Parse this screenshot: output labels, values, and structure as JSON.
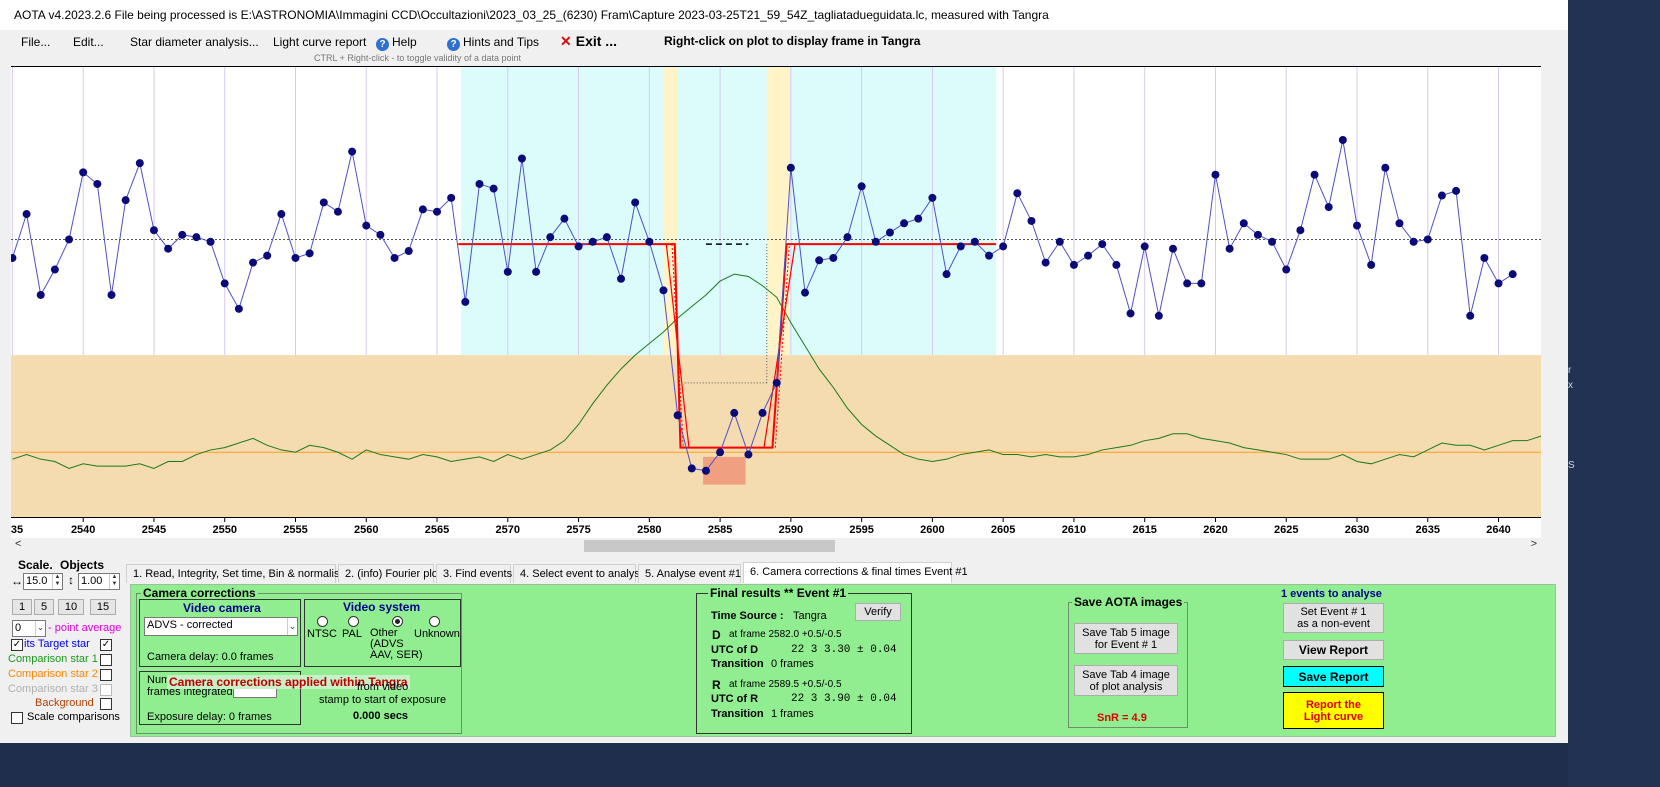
{
  "window": {
    "title": "AOTA v4.2023.2.6    File being processed is E:\\ASTRONOMIA\\Immagini CCD\\Occultazioni\\2023_03_25_(6230) Fram\\Capture 2023-03-25T21_59_54Z_tagliatadueguidata.lc, measured with Tangra"
  },
  "menu": {
    "file": "File...",
    "edit": "Edit...",
    "star_diameter": "Star diameter analysis...",
    "light_curve_report": "Light curve report",
    "help": "Help",
    "hints": "Hints and Tips",
    "exit": "Exit ...",
    "right_click_hint": "Right-click on plot to display frame in Tangra",
    "ctrl_hint": "CTRL + Right-click  -  to toggle validity of a data point"
  },
  "icons": {
    "help": "question-circle-icon",
    "hints": "question-circle-icon",
    "exit": "close-x-icon"
  },
  "colors": {
    "data_point": "#0a0a78",
    "data_line": "#5050c8",
    "model": "#ff0000",
    "comparison_green": "#1a7a1a",
    "background_orange": "#ffa020",
    "lower_band": "#f5dbb0",
    "cyan_region": "#dcfcfc",
    "yellow_region": "#fff4c8",
    "panel_green": "#90ee90",
    "save_report": "#00ffff",
    "report_light_curve": "#ffff00",
    "snr": "#e00000"
  },
  "chart_data": {
    "type": "line",
    "xlim": [
      2534.9,
      2643.0
    ],
    "x_ticks": [
      2540,
      2545,
      2550,
      2555,
      2560,
      2565,
      2570,
      2575,
      2580,
      2585,
      2590,
      2595,
      2600,
      2605,
      2610,
      2615,
      2620,
      2625,
      2630,
      2635,
      2640
    ],
    "x_tick_labels": [
      "35",
      "2540",
      "2545",
      "2550",
      "2555",
      "2560",
      "2565",
      "2570",
      "2575",
      "2580",
      "2585",
      "2590",
      "2595",
      "2600",
      "2605",
      "2610",
      "2615",
      "2620",
      "2625",
      "2630",
      "2635",
      "2640"
    ],
    "ylim": [
      -0.2,
      1.75
    ],
    "grid": true,
    "baseline_level": 1.0,
    "regions": [
      {
        "kind": "cyan",
        "x_from": 2566.7,
        "x_to": 2581.0
      },
      {
        "kind": "yellow",
        "x_from": 2581.0,
        "x_to": 2582.0
      },
      {
        "kind": "cyan",
        "x_from": 2582.0,
        "x_to": 2588.3
      },
      {
        "kind": "yellow",
        "x_from": 2588.3,
        "x_to": 2589.9
      },
      {
        "kind": "cyan",
        "x_from": 2589.9,
        "x_to": 2604.5
      },
      {
        "kind": "salmon",
        "x_from": 2583.8,
        "x_to": 2586.8,
        "y_from": -0.06,
        "y_to": 0.06
      }
    ],
    "lower_band_below": 0.5,
    "series": [
      {
        "name": "Target star",
        "x_start": 2535,
        "values": [
          0.92,
          1.11,
          0.76,
          0.87,
          1.0,
          1.29,
          1.24,
          0.76,
          1.17,
          1.33,
          1.04,
          0.96,
          1.02,
          1.01,
          0.99,
          0.81,
          0.7,
          0.9,
          0.93,
          1.11,
          0.92,
          0.94,
          1.16,
          1.12,
          1.38,
          1.06,
          1.02,
          0.92,
          0.95,
          1.13,
          1.12,
          1.18,
          0.73,
          1.24,
          1.22,
          0.86,
          1.35,
          0.86,
          1.01,
          1.09,
          0.97,
          0.99,
          1.01,
          0.83,
          1.16,
          0.99,
          0.78,
          0.24,
          0.01,
          0.0,
          0.08,
          0.25,
          0.07,
          0.25,
          0.38,
          1.31,
          0.77,
          0.91,
          0.92,
          1.01,
          1.23,
          0.99,
          1.03,
          1.07,
          1.09,
          1.18,
          0.85,
          0.97,
          0.99,
          0.93,
          0.97,
          1.2,
          1.08,
          0.9,
          0.99,
          0.89,
          0.93,
          0.98,
          0.89,
          0.68,
          0.97,
          0.67,
          0.96,
          0.81,
          0.81,
          1.28,
          0.96,
          1.07,
          1.02,
          0.99,
          0.87,
          1.04,
          1.28,
          1.14,
          1.43,
          1.06,
          0.89,
          1.31,
          1.07,
          0.99,
          1.0,
          1.19,
          1.21,
          0.67,
          0.92,
          0.81,
          0.85
        ]
      },
      {
        "name": "Comparison star 1",
        "x_start": 2535,
        "values": [
          0.05,
          0.07,
          0.05,
          0.04,
          0.01,
          0.03,
          0.02,
          0.02,
          0.02,
          0.03,
          0.01,
          0.04,
          0.04,
          0.07,
          0.09,
          0.1,
          0.12,
          0.14,
          0.11,
          0.09,
          0.08,
          0.11,
          0.1,
          0.08,
          0.05,
          0.09,
          0.07,
          0.06,
          0.05,
          0.07,
          0.06,
          0.04,
          0.05,
          0.06,
          0.04,
          0.07,
          0.05,
          0.07,
          0.09,
          0.13,
          0.2,
          0.29,
          0.37,
          0.44,
          0.5,
          0.55,
          0.6,
          0.66,
          0.71,
          0.76,
          0.82,
          0.85,
          0.84,
          0.8,
          0.75,
          0.64,
          0.54,
          0.44,
          0.36,
          0.27,
          0.2,
          0.15,
          0.11,
          0.07,
          0.05,
          0.04,
          0.05,
          0.07,
          0.08,
          0.09,
          0.07,
          0.07,
          0.06,
          0.07,
          0.06,
          0.06,
          0.07,
          0.09,
          0.1,
          0.11,
          0.13,
          0.14,
          0.16,
          0.16,
          0.14,
          0.13,
          0.12,
          0.1,
          0.09,
          0.08,
          0.07,
          0.05,
          0.05,
          0.05,
          0.07,
          0.04,
          0.03,
          0.05,
          0.07,
          0.06,
          0.09,
          0.12,
          0.11,
          0.11,
          0.09,
          0.11,
          0.13,
          0.13,
          0.15,
          0.2,
          0.23,
          0.23
        ]
      }
    ],
    "model": {
      "baseline": 0.98,
      "event_level": 0.1,
      "d_frame": 2582.0,
      "r_frame": 2589.5
    },
    "comparison_line_level": 0.08
  },
  "left_panel": {
    "scale_label": "Scale.",
    "objects_label": "Objects",
    "scale_h_value": "15.0",
    "scale_v_value": "1.00",
    "scale_buttons": [
      "1",
      "5",
      "10",
      "15"
    ],
    "point_average_value": "0",
    "point_average_label": "- point average",
    "rows": [
      {
        "label": "its  Target star",
        "color": "#0000ff",
        "checked": true
      },
      {
        "label": "Comparison star 1",
        "color": "#1a9a1a",
        "checked": false
      },
      {
        "label": "Comparison star 2",
        "color": "#ff8800",
        "checked": false
      },
      {
        "label": "Comparison star 3",
        "color": "#b0b0b0",
        "checked": false
      },
      {
        "label": "Background",
        "color": "#b04000",
        "checked": false
      }
    ],
    "scale_comparisons": "Scale comparisons"
  },
  "tabs": [
    "1.  Read, Integrity, Set time, Bin & normalise",
    "2. (info)  Fourier plot",
    "3. Find events",
    "4. Select event to analyse",
    "5. Analyse event #1",
    "6. Camera corrections & final times Event #1"
  ],
  "camera": {
    "title": "Camera corrections",
    "video_camera_label": "Video camera",
    "camera_select": "ADVS - corrected",
    "camera_delay": "Camera delay: 0.0 frames",
    "video_system_label": "Video system",
    "video_options": [
      "NTSC",
      "PAL",
      "Other\n(ADVS\nAAV, SER)",
      "Unknown"
    ],
    "frames_integrated_label": "Num\nframes integrated",
    "applied_banner": "Camera corrections applied within Tangra",
    "timestamp_text": "from video\nstamp to start of exposure",
    "timestamp_value": "0.000 secs",
    "exposure_delay": "Exposure delay: 0 frames"
  },
  "final_results": {
    "title": "Final results  **  Event #1",
    "time_source_label": "Time Source :",
    "time_source": "Tangra",
    "verify": "Verify",
    "d_label": "D",
    "d_frame": "at frame 2582.0  +0.5/-0.5",
    "utc_d_label": "UTC of D",
    "utc_d": "22  3  3.30  ± 0.04",
    "transition_label": "Transition",
    "d_transition": "0 frames",
    "r_label": "R",
    "r_frame": "at frame 2589.5  +0.5/-0.5",
    "utc_r_label": "UTC of R",
    "utc_r": "22  3  3.90  ± 0.04",
    "r_transition": "1 frames"
  },
  "save_images": {
    "title": "Save AOTA images",
    "tab5": "Save Tab 5 image\nfor Event # 1",
    "tab4": "Save Tab 4 image\nof plot analysis",
    "snr": "SnR = 4.9"
  },
  "events": {
    "title": "1  events to analyse",
    "set_event": "Set Event # 1\nas a non-event",
    "view_report": "View Report",
    "save_report": "Save Report",
    "report_lc": "Report the\nLight curve"
  }
}
